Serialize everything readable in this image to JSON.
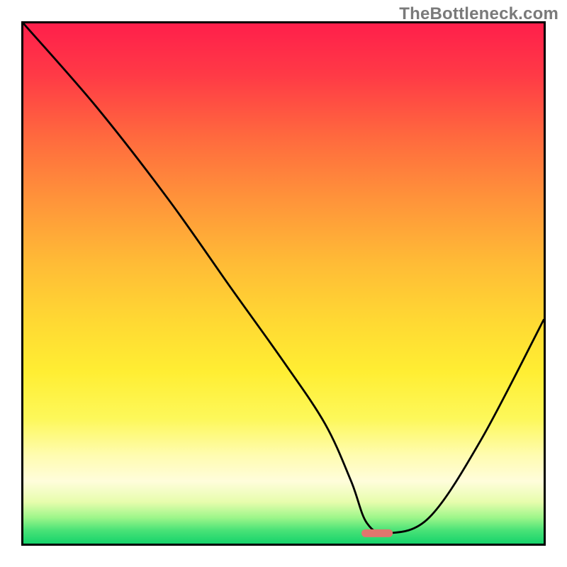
{
  "watermark": "TheBottleneck.com",
  "chart_data": {
    "type": "line",
    "title": "",
    "xlabel": "",
    "ylabel": "",
    "xlim": [
      0,
      100
    ],
    "ylim": [
      0,
      100
    ],
    "grid": false,
    "series": [
      {
        "name": "bottleneck-curve",
        "x": [
          0,
          14,
          28,
          40,
          50,
          58,
          63,
          66,
          70,
          78,
          88,
          100
        ],
        "values": [
          100,
          84,
          66,
          49,
          35,
          23,
          12,
          4,
          2,
          5,
          20,
          43
        ]
      }
    ],
    "annotations": [
      {
        "name": "minimum-marker",
        "type": "capsule",
        "x_range": [
          65,
          71
        ],
        "y": 2
      }
    ],
    "background": {
      "type": "vertical-gradient",
      "stops": [
        {
          "pct": 0,
          "color": "#ff1f4b"
        },
        {
          "pct": 10,
          "color": "#ff3a46"
        },
        {
          "pct": 22,
          "color": "#ff6a3e"
        },
        {
          "pct": 34,
          "color": "#ff943a"
        },
        {
          "pct": 46,
          "color": "#ffbb36"
        },
        {
          "pct": 57,
          "color": "#ffd833"
        },
        {
          "pct": 67,
          "color": "#ffee33"
        },
        {
          "pct": 76,
          "color": "#fdf85a"
        },
        {
          "pct": 83,
          "color": "#fffcb0"
        },
        {
          "pct": 88,
          "color": "#fffddb"
        },
        {
          "pct": 92,
          "color": "#e7fdad"
        },
        {
          "pct": 95,
          "color": "#9df68a"
        },
        {
          "pct": 97.5,
          "color": "#48e277"
        },
        {
          "pct": 100,
          "color": "#16d36b"
        }
      ]
    }
  }
}
